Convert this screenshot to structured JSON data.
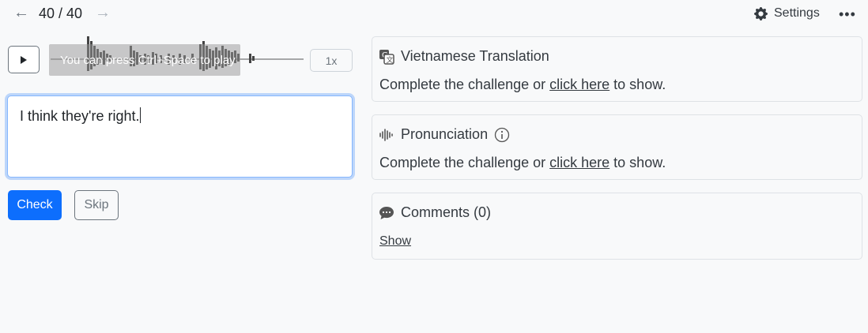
{
  "nav": {
    "prev_arrow": "←",
    "counter": "40 / 40",
    "next_arrow": "→",
    "settings_label": "Settings",
    "more_label": "•••"
  },
  "player": {
    "hint": "You can press Ctrl+Space to play",
    "speed": "1x"
  },
  "answer": {
    "text": "I think they're right."
  },
  "actions": {
    "check": "Check",
    "skip": "Skip"
  },
  "cards": {
    "translation": {
      "title": "Vietnamese Translation",
      "body_prefix": "Complete the challenge or ",
      "link": "click here",
      "body_suffix": " to show."
    },
    "pronunciation": {
      "title": "Pronunciation",
      "body_prefix": "Complete the challenge or ",
      "link": "click here",
      "body_suffix": " to show."
    },
    "comments": {
      "title": "Comments (0)",
      "show": "Show"
    }
  },
  "colors": {
    "primary": "#0d6efd",
    "background": "#f8f9fa",
    "border": "#dee2e6"
  }
}
